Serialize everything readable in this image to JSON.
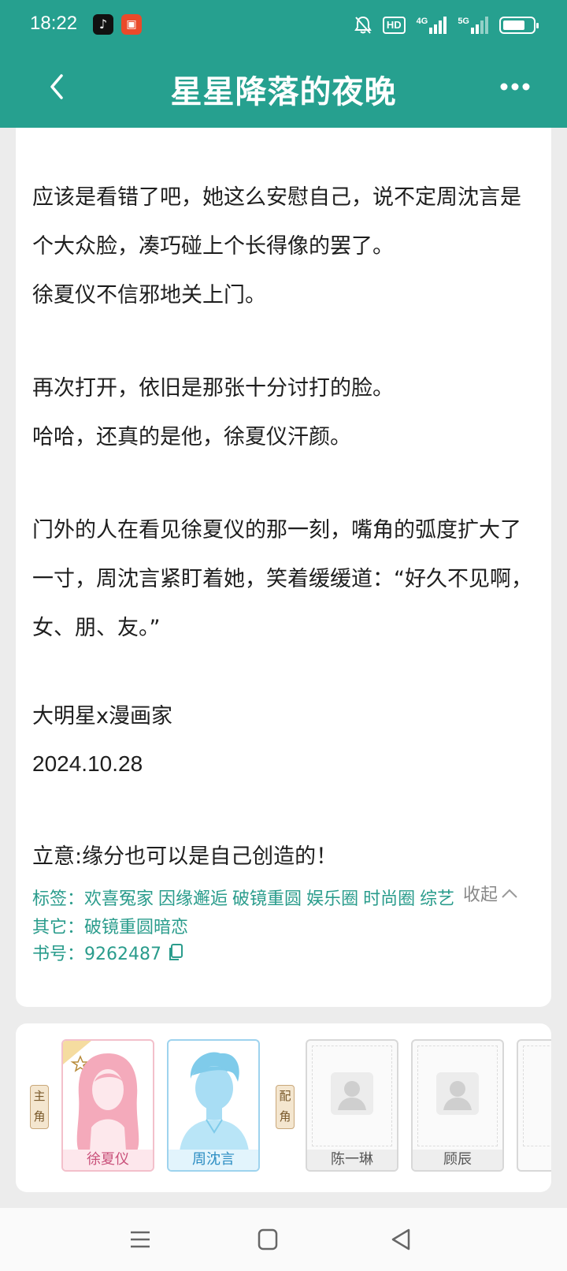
{
  "status_bar": {
    "time": "18:22",
    "hd_label": "HD",
    "net1": "4G",
    "net2": "5G",
    "battery_level": 0.75,
    "icons": [
      "tiktok-icon",
      "app-icon",
      "mute-icon",
      "hd-icon",
      "signal-4g-icon",
      "signal-5g-icon",
      "battery-icon"
    ]
  },
  "header": {
    "title": "星星降落的夜晚",
    "back_icon": "chevron-left-icon",
    "more_icon": "more-dots-icon"
  },
  "summary": {
    "p1": "应该是看错了吧，她这么安慰自己，说不定周沈言是个大众脸，凑巧碰上个长得像的罢了。",
    "p2": "徐夏仪不信邪地关上门。",
    "p3": "再次打开，依旧是那张十分讨打的脸。",
    "p4": "哈哈，还真的是他，徐夏仪汗颜。",
    "p5": "门外的人在看见徐夏仪的那一刻，嘴角的弧度扩大了一寸，周沈言紧盯着她，笑着缓缓道：“好久不见啊，女、朋、友。”",
    "p6": "大明星x漫画家",
    "p7": "2024.10.28",
    "p8": "立意:缘分也可以是自己创造的！",
    "collapse_label": "收起"
  },
  "meta": {
    "tags_label": "标签：",
    "tags": [
      "欢喜冤家",
      "因缘邂逅",
      "破镜重圆",
      "娱乐圈",
      "时尚圈",
      "综艺"
    ],
    "other_label": "其它：",
    "other_value": "破镜重圆暗恋",
    "book_label": "书号：",
    "book_no": "9262487"
  },
  "roles": {
    "main_label": "主角",
    "supporting_label": "配角",
    "main": [
      {
        "name": "徐夏仪"
      },
      {
        "name": "周沈言"
      }
    ],
    "supporting": [
      {
        "name": "陈一琳"
      },
      {
        "name": "顾辰"
      }
    ]
  }
}
